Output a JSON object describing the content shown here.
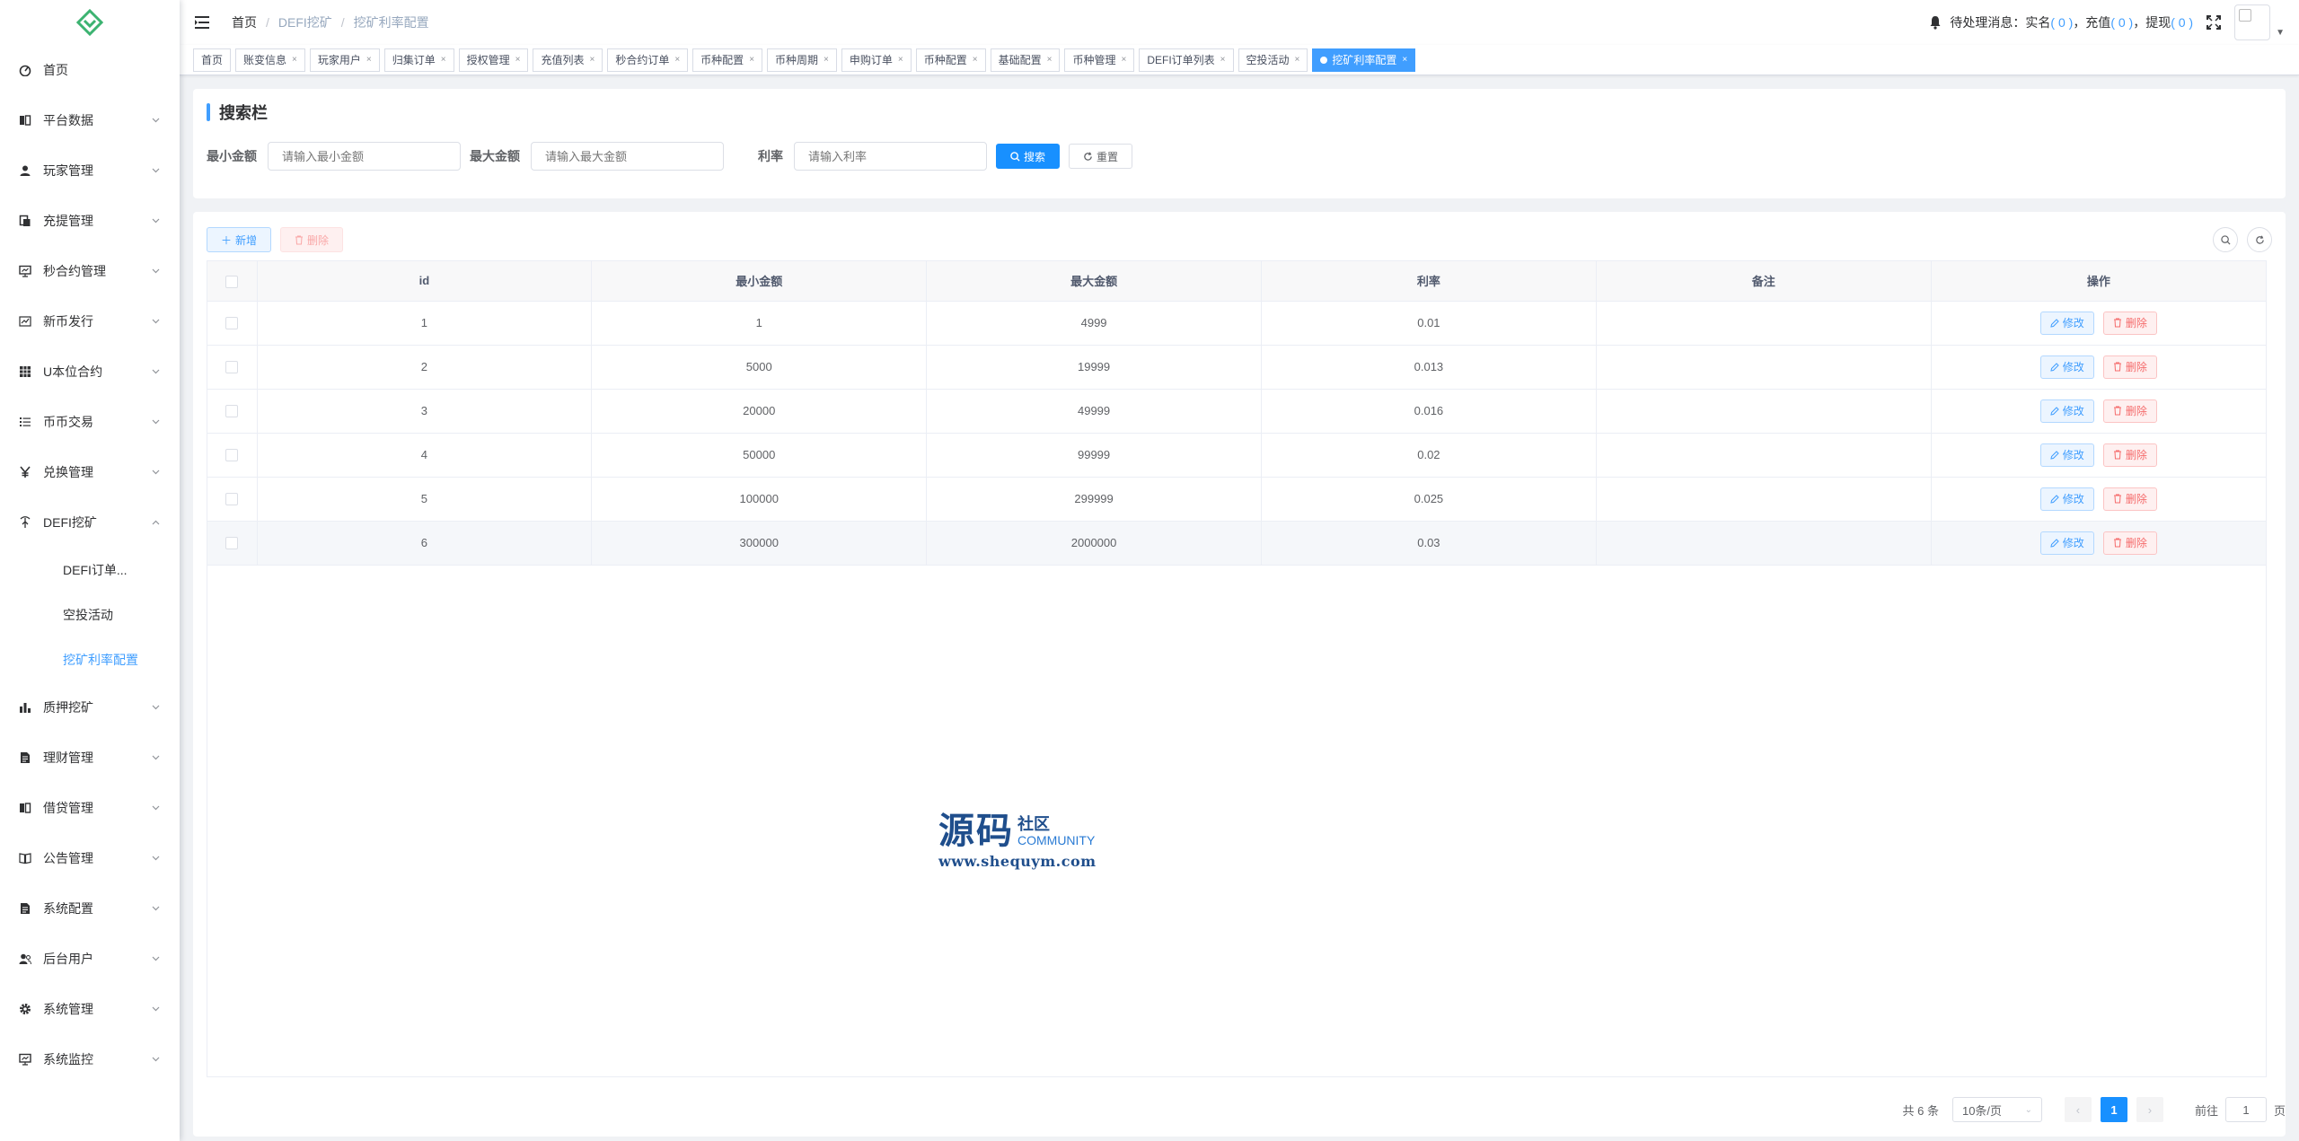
{
  "sidebar": {
    "items": [
      {
        "label": "首页",
        "icon": "dashboard-icon"
      },
      {
        "label": "平台数据",
        "icon": "book-icon"
      },
      {
        "label": "玩家管理",
        "icon": "user-icon"
      },
      {
        "label": "充提管理",
        "icon": "clipboard-icon"
      },
      {
        "label": "秒合约管理",
        "icon": "monitor-icon"
      },
      {
        "label": "新币发行",
        "icon": "chart-icon"
      },
      {
        "label": "U本位合约",
        "icon": "grid-icon"
      },
      {
        "label": "币币交易",
        "icon": "list-icon"
      },
      {
        "label": "兑换管理",
        "icon": "yen-icon"
      },
      {
        "label": "DEFI挖矿",
        "icon": "mining-icon"
      }
    ],
    "sub_items": [
      {
        "label": "DEFI订单..."
      },
      {
        "label": "空投活动"
      },
      {
        "label": "挖矿利率配置"
      }
    ],
    "items_after": [
      {
        "label": "质押挖矿",
        "icon": "bar-chart-icon"
      },
      {
        "label": "理财管理",
        "icon": "document-icon"
      },
      {
        "label": "借贷管理",
        "icon": "book-icon"
      },
      {
        "label": "公告管理",
        "icon": "open-book-icon"
      },
      {
        "label": "系统配置",
        "icon": "document-icon"
      },
      {
        "label": "后台用户",
        "icon": "users-icon"
      },
      {
        "label": "系统管理",
        "icon": "gear-icon"
      },
      {
        "label": "系统监控",
        "icon": "monitor-icon"
      }
    ]
  },
  "navbar": {
    "breadcrumb": [
      "首页",
      "DEFI挖矿",
      "挖矿利率配置"
    ],
    "notice_prefix": "待处理消息：实名",
    "notice_realname": "( 0 )",
    "notice_recharge_label": "，充值",
    "notice_recharge": "( 0 )",
    "notice_withdraw_label": "，提现",
    "notice_withdraw": "( 0 )"
  },
  "tags": [
    "首页",
    "账变信息",
    "玩家用户",
    "归集订单",
    "授权管理",
    "充值列表",
    "秒合约订单",
    "币种配置",
    "币种周期",
    "申购订单",
    "币种配置",
    "基础配置",
    "币种管理",
    "DEFI订单列表",
    "空投活动"
  ],
  "active_tag": "挖矿利率配置",
  "search": {
    "title": "搜索栏",
    "min_label": "最小金额",
    "min_placeholder": "请输入最小金额",
    "max_label": "最大金额",
    "max_placeholder": "请输入最大金额",
    "rate_label": "利率",
    "rate_placeholder": "请输入利率",
    "search_button": "搜索",
    "reset_button": "重置"
  },
  "toolbar": {
    "add_button": "新增",
    "delete_button": "删除"
  },
  "table": {
    "columns": [
      "id",
      "最小金额",
      "最大金额",
      "利率",
      "备注",
      "操作"
    ],
    "edit_label": "修改",
    "delete_label": "删除",
    "rows": [
      {
        "id": "1",
        "min": "1",
        "max": "4999",
        "rate": "0.01",
        "note": ""
      },
      {
        "id": "2",
        "min": "5000",
        "max": "19999",
        "rate": "0.013",
        "note": ""
      },
      {
        "id": "3",
        "min": "20000",
        "max": "49999",
        "rate": "0.016",
        "note": ""
      },
      {
        "id": "4",
        "min": "50000",
        "max": "99999",
        "rate": "0.02",
        "note": ""
      },
      {
        "id": "5",
        "min": "100000",
        "max": "299999",
        "rate": "0.025",
        "note": ""
      },
      {
        "id": "6",
        "min": "300000",
        "max": "2000000",
        "rate": "0.03",
        "note": ""
      }
    ]
  },
  "watermark": {
    "big": "源码",
    "small": "社区",
    "eng": "COMMUNITY",
    "url": "www.shequym.com"
  },
  "pagination": {
    "total": "共 6 条",
    "page_size": "10条/页",
    "current_page": "1",
    "jump_prefix": "前往",
    "jump_value": "1",
    "jump_suffix": "页"
  },
  "colors": {
    "primary": "#1890ff",
    "accent": "#409eff",
    "danger": "#f56c6c"
  }
}
